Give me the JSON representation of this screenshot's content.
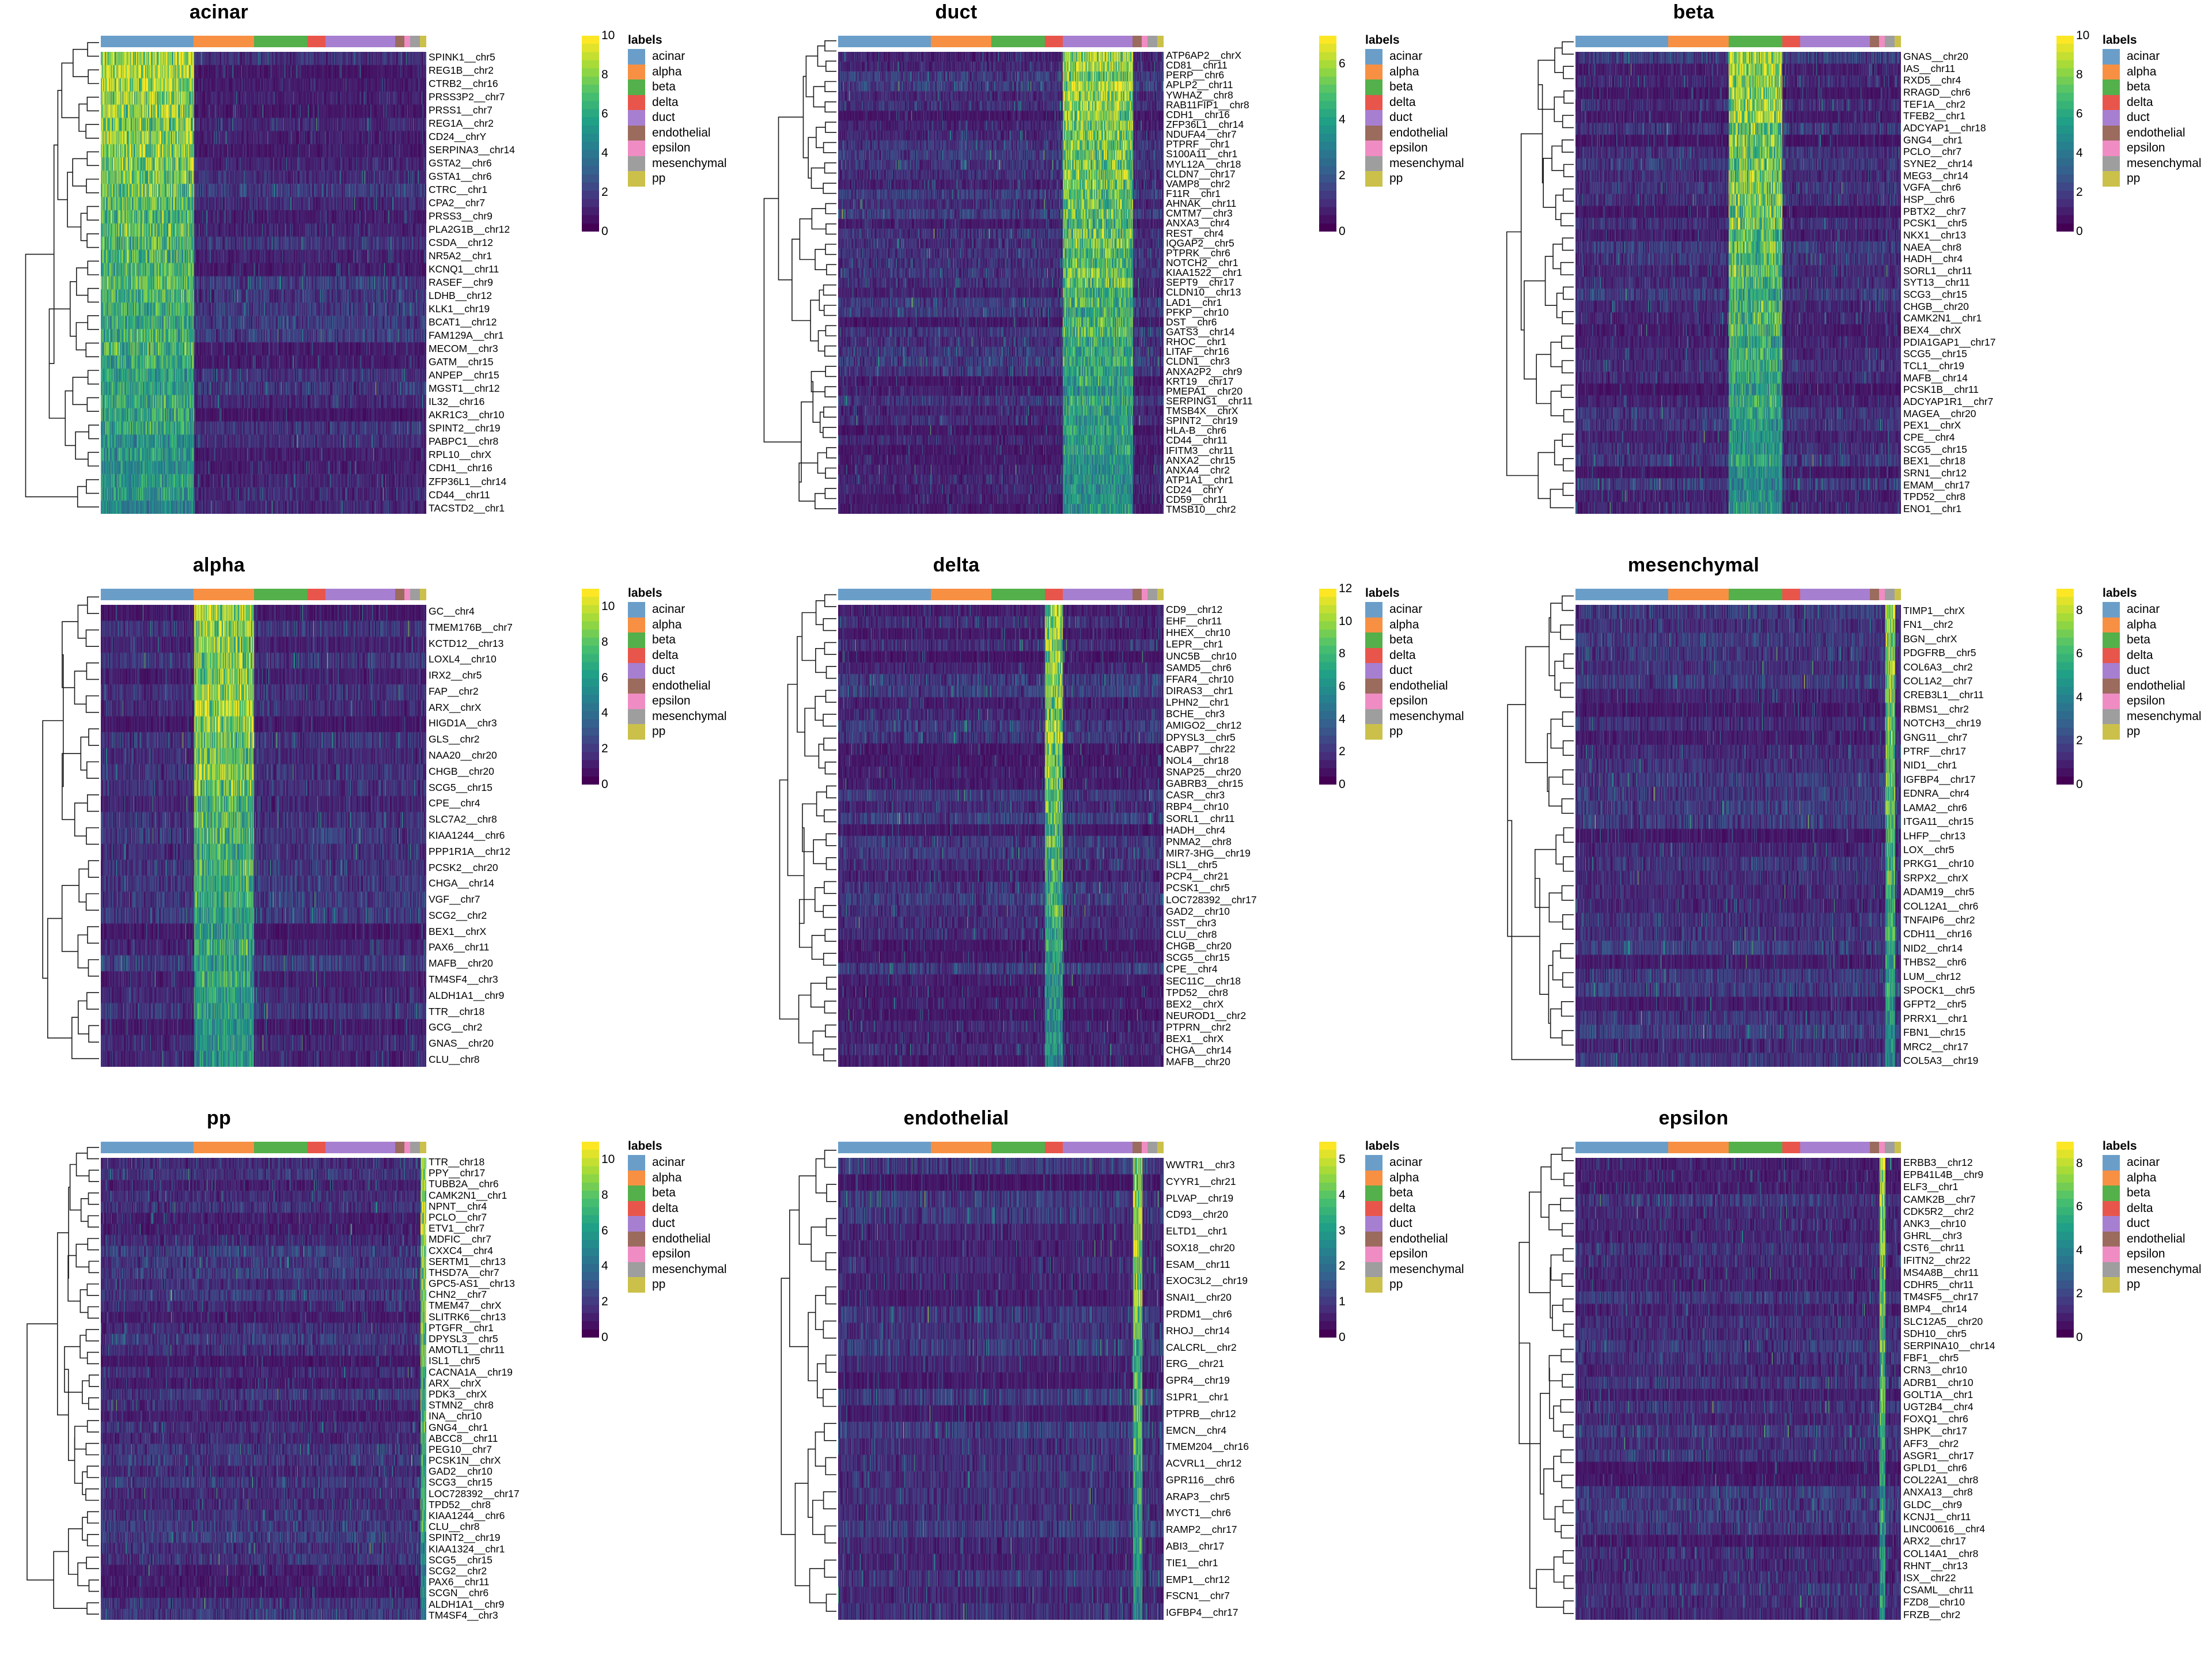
{
  "figure": {
    "type": "heatmap-grid",
    "rows": 3,
    "cols": 3,
    "colormap": "viridis",
    "legend_title": "labels",
    "class_labels": [
      "acinar",
      "alpha",
      "beta",
      "delta",
      "duct",
      "endothelial",
      "epsilon",
      "mesenchymal",
      "pp"
    ],
    "class_colors": [
      "#6A9EC9",
      "#F79043",
      "#54B04A",
      "#E8564B",
      "#A77FD0",
      "#9B6B5E",
      "#F08CC4",
      "#9E9E9E",
      "#CBC14A"
    ],
    "column_group_order": [
      "acinar",
      "alpha",
      "beta",
      "delta",
      "duct",
      "endothelial",
      "epsilon",
      "mesenchymal",
      "pp"
    ],
    "column_group_fractions": [
      0.285,
      0.185,
      0.165,
      0.055,
      0.215,
      0.028,
      0.018,
      0.03,
      0.019
    ],
    "viridis_stops": [
      "#440154",
      "#46327e",
      "#365c8d",
      "#277f8e",
      "#1fa187",
      "#4ac16d",
      "#a0da39",
      "#fde725"
    ]
  },
  "chart_data": [
    {
      "type": "heatmap",
      "title": "acinar",
      "panel_index": 0,
      "colorbar": {
        "min": 0,
        "max": 10,
        "ticks": [
          0,
          2,
          4,
          6,
          8,
          10
        ]
      },
      "ylabel": "",
      "xlabel": "",
      "genes": [
        "SPINK1__chr5",
        "REG1B__chr2",
        "CTRB2__chr16",
        "PRSS3P2__chr7",
        "PRSS1__chr7",
        "REG1A__chr2",
        "CD24__chrY",
        "SERPINA3__chr14",
        "GSTA2__chr6",
        "GSTA1__chr6",
        "CTRC__chr1",
        "CPA2__chr7",
        "PRSS3__chr9",
        "PLA2G1B__chr12",
        "CSDA__chr12",
        "NR5A2__chr1",
        "KCNQ1__chr11",
        "RASEF__chr9",
        "LDHB__chr12",
        "KLK1__chr19",
        "BCAT1__chr12",
        "FAM129A__chr1",
        "MECOM__chr3",
        "GATM__chr15",
        "ANPEP__chr15",
        "MGST1__chr12",
        "IL32__chr16",
        "AKR1C3__chr10",
        "SPINT2__chr19",
        "PABPC1__chr8",
        "RPL10__chrX",
        "CDH1__chr16",
        "ZFP36L1__chr14",
        "CD44__chr11",
        "TACSTD2__chr1"
      ],
      "high_block": "acinar"
    },
    {
      "type": "heatmap",
      "title": "duct",
      "panel_index": 1,
      "colorbar": {
        "min": 0,
        "max": 7,
        "ticks": [
          0,
          2,
          4,
          6
        ]
      },
      "ylabel": "",
      "xlabel": "",
      "genes": [
        "ATP6AP2__chrX",
        "CD81__chr11",
        "PERP__chr6",
        "APLP2__chr11",
        "YWHAZ__chr8",
        "RAB11FIP1__chr8",
        "CDH1__chr16",
        "ZFP36L1__chr14",
        "NDUFA4__chr7",
        "PTPRF__chr1",
        "S100A11__chr1",
        "MYL12A__chr18",
        "CLDN7__chr17",
        "VAMP8__chr2",
        "F11R__chr1",
        "AHNAK__chr11",
        "CMTM7__chr3",
        "ANXA3__chr4",
        "REST__chr4",
        "IQGAP2__chr5",
        "PTPRK__chr6",
        "NOTCH2__chr1",
        "KIAA1522__chr1",
        "SEPT9__chr17",
        "CLDN10__chr13",
        "LAD1__chr1",
        "PFKP__chr10",
        "DST__chr6",
        "GATS3__chr14",
        "RHOC__chr1",
        "LITAF__chr16",
        "CLDN1__chr3",
        "ANXA2P2__chr9",
        "KRT19__chr17",
        "PMEPA1__chr20",
        "SERPING1__chr11",
        "TMSB4X__chrX",
        "SPINT2__chr19",
        "HLA-B__chr6",
        "CD44__chr11",
        "IFITM3__chr11",
        "ANXA2__chr15",
        "ANXA4__chr2",
        "ATP1A1__chr1",
        "CD24__chrY",
        "CD59__chr11",
        "TMSB10__chr2"
      ],
      "high_block": "duct"
    },
    {
      "type": "heatmap",
      "title": "beta",
      "panel_index": 2,
      "colorbar": {
        "min": 0,
        "max": 10,
        "ticks": [
          0,
          2,
          4,
          6,
          8,
          10
        ]
      },
      "ylabel": "",
      "xlabel": "",
      "genes": [
        "GNAS__chr20",
        "IAS__chr11",
        "RXD5__chr4",
        "RRAGD__chr6",
        "TEF1A__chr2",
        "TFEB2__chr1",
        "ADCYAP1__chr18",
        "GNG4__chr1",
        "PCLO__chr7",
        "SYNE2__chr14",
        "MEG3__chr14",
        "VGFA__chr6",
        "HSP__chr6",
        "PBTX2__chr7",
        "PCSK1__chr5",
        "NKX1__chr13",
        "NAEA__chr8",
        "HADH__chr4",
        "SORL1__chr11",
        "SYT13__chr11",
        "SCG3__chr15",
        "CHGB__chr20",
        "CAMK2N1__chr1",
        "BEX4__chrX",
        "PDIA1GAP1__chr17",
        "SCG5__chr15",
        "TCL1__chr19",
        "MAFB__chr14",
        "PCSK1B__chr11",
        "ADCYAP1R1__chr7",
        "MAGEA__chr20",
        "PEX1__chrX",
        "CPE__chr4",
        "SCG5__chr15",
        "BEX1__chr18",
        "SRN1__chr12",
        "EMAM__chr17",
        "TPD52__chr8",
        "ENO1__chr1"
      ],
      "high_block": "beta"
    },
    {
      "type": "heatmap",
      "title": "alpha",
      "panel_index": 3,
      "colorbar": {
        "min": 0,
        "max": 11,
        "ticks": [
          0,
          2,
          4,
          6,
          8,
          10
        ]
      },
      "ylabel": "",
      "xlabel": "",
      "genes": [
        "GC__chr4",
        "TMEM176B__chr7",
        "KCTD12__chr13",
        "LOXL4__chr10",
        "IRX2__chr5",
        "FAP__chr2",
        "ARX__chrX",
        "HIGD1A__chr3",
        "GLS__chr2",
        "NAA20__chr20",
        "CHGB__chr20",
        "SCG5__chr15",
        "CPE__chr4",
        "SLC7A2__chr8",
        "KIAA1244__chr6",
        "PPP1R1A__chr12",
        "PCSK2__chr20",
        "CHGA__chr14",
        "VGF__chr7",
        "SCG2__chr2",
        "BEX1__chrX",
        "PAX6__chr11",
        "MAFB__chr20",
        "TM4SF4__chr3",
        "ALDH1A1__chr9",
        "TTR__chr18",
        "GCG__chr2",
        "GNAS__chr20",
        "CLU__chr8"
      ],
      "high_block": "alpha"
    },
    {
      "type": "heatmap",
      "title": "delta",
      "panel_index": 4,
      "colorbar": {
        "min": 0,
        "max": 12,
        "ticks": [
          0,
          2,
          4,
          6,
          8,
          10,
          12
        ]
      },
      "ylabel": "",
      "xlabel": "",
      "genes": [
        "CD9__chr12",
        "EHF__chr11",
        "HHEX__chr10",
        "LEPR__chr1",
        "UNC5B__chr10",
        "SAMD5__chr6",
        "FFAR4__chr10",
        "DIRAS3__chr1",
        "LPHN2__chr1",
        "BCHE__chr3",
        "AMIGO2__chr12",
        "DPYSL3__chr5",
        "CABP7__chr22",
        "NOL4__chr18",
        "SNAP25__chr20",
        "GABRB3__chr15",
        "CASR__chr3",
        "RBP4__chr10",
        "SORL1__chr11",
        "HADH__chr4",
        "PNMA2__chr8",
        "MIR7-3HG__chr19",
        "ISL1__chr5",
        "PCP4__chr21",
        "PCSK1__chr5",
        "LOC728392__chr17",
        "GAD2__chr10",
        "SST__chr3",
        "CLU__chr8",
        "CHGB__chr20",
        "SCG5__chr15",
        "CPE__chr4",
        "SEC11C__chr18",
        "TPD52__chr8",
        "BEX2__chrX",
        "NEUROD1__chr2",
        "PTPRN__chr2",
        "BEX1__chrX",
        "CHGA__chr14",
        "MAFB__chr20"
      ],
      "high_block": "delta"
    },
    {
      "type": "heatmap",
      "title": "mesenchymal",
      "panel_index": 5,
      "colorbar": {
        "min": 0,
        "max": 9,
        "ticks": [
          0,
          2,
          4,
          6,
          8
        ]
      },
      "ylabel": "",
      "xlabel": "",
      "genes": [
        "TIMP1__chrX",
        "FN1__chr2",
        "BGN__chrX",
        "PDGFRB__chr5",
        "COL6A3__chr2",
        "COL1A2__chr7",
        "CREB3L1__chr11",
        "RBMS1__chr2",
        "NOTCH3__chr19",
        "GNG11__chr7",
        "PTRF__chr17",
        "NID1__chr1",
        "IGFBP4__chr17",
        "EDNRA__chr4",
        "LAMA2__chr6",
        "ITGA11__chr15",
        "LHFP__chr13",
        "LOX__chr5",
        "PRKG1__chr10",
        "SRPX2__chrX",
        "ADAM19__chr5",
        "COL12A1__chr6",
        "TNFAIP6__chr2",
        "CDH11__chr16",
        "NID2__chr14",
        "THBS2__chr6",
        "LUM__chr12",
        "SPOCK1__chr5",
        "GFPT2__chr5",
        "PRRX1__chr1",
        "FBN1__chr15",
        "MRC2__chr17",
        "COL5A3__chr19"
      ],
      "high_block": "mesenchymal"
    },
    {
      "type": "heatmap",
      "title": "pp",
      "panel_index": 6,
      "colorbar": {
        "min": 0,
        "max": 11,
        "ticks": [
          0,
          2,
          4,
          6,
          8,
          10
        ]
      },
      "ylabel": "",
      "xlabel": "",
      "genes": [
        "TTR__chr18",
        "PPY__chr17",
        "TUBB2A__chr6",
        "CAMK2N1__chr1",
        "NPNT__chr4",
        "PCLO__chr7",
        "ETV1__chr7",
        "MDFIC__chr7",
        "CXXC4__chr4",
        "SERTM1__chr13",
        "THSD7A__chr7",
        "GPC5-AS1__chr13",
        "CHN2__chr7",
        "TMEM47__chrX",
        "SLITRK6__chr13",
        "PTGFR__chr1",
        "DPYSL3__chr5",
        "AMOTL1__chr11",
        "ISL1__chr5",
        "CACNA1A__chr19",
        "ARX__chrX",
        "PDK3__chrX",
        "STMN2__chr8",
        "INA__chr10",
        "GNG4__chr1",
        "ABCC8__chr11",
        "PEG10__chr7",
        "PCSK1N__chrX",
        "GAD2__chr10",
        "SCG3__chr15",
        "LOC728392__chr17",
        "TPD52__chr8",
        "KIAA1244__chr6",
        "CLU__chr8",
        "SPINT2__chr19",
        "KIAA1324__chr1",
        "SCG5__chr15",
        "SCG2__chr2",
        "PAX6__chr11",
        "SCGN__chr6",
        "ALDH1A1__chr9",
        "TM4SF4__chr3"
      ],
      "high_block": "pp"
    },
    {
      "type": "heatmap",
      "title": "endothelial",
      "panel_index": 7,
      "colorbar": {
        "min": 0,
        "max": 5.5,
        "ticks": [
          0,
          1,
          2,
          3,
          4,
          5
        ]
      },
      "ylabel": "",
      "xlabel": "",
      "genes": [
        "WWTR1__chr3",
        "CYYR1__chr21",
        "PLVAP__chr19",
        "CD93__chr20",
        "ELTD1__chr1",
        "SOX18__chr20",
        "ESAM__chr11",
        "EXOC3L2__chr19",
        "SNAI1__chr20",
        "PRDM1__chr6",
        "RHOJ__chr14",
        "CALCRL__chr2",
        "ERG__chr21",
        "GPR4__chr19",
        "S1PR1__chr1",
        "PTPRB__chr12",
        "EMCN__chr4",
        "TMEM204__chr16",
        "ACVRL1__chr12",
        "GPR116__chr6",
        "ARAP3__chr5",
        "MYCT1__chr6",
        "RAMP2__chr17",
        "ABI3__chr17",
        "TIE1__chr1",
        "EMP1__chr12",
        "FSCN1__chr7",
        "IGFBP4__chr17"
      ],
      "high_block": "endothelial"
    },
    {
      "type": "heatmap",
      "title": "epsilon",
      "panel_index": 8,
      "colorbar": {
        "min": 0,
        "max": 9,
        "ticks": [
          0,
          2,
          4,
          6,
          8
        ]
      },
      "ylabel": "",
      "xlabel": "",
      "genes": [
        "ERBB3__chr12",
        "EPB41L4B__chr9",
        "ELF3__chr1",
        "CAMK2B__chr7",
        "CDK5R2__chr2",
        "ANK3__chr10",
        "GHRL__chr3",
        "CST6__chr11",
        "IFITN2__chr22",
        "MS4A8B__chr11",
        "CDHR5__chr11",
        "TM4SF5__chr17",
        "BMP4__chr14",
        "SLC12A5__chr20",
        "SDH10__chr5",
        "SERPINA10__chr14",
        "FBF1__chr5",
        "CRN3__chr10",
        "ADRB1__chr10",
        "GOLT1A__chr1",
        "UGT2B4__chr4",
        "FOXQ1__chr6",
        "SHPK__chr17",
        "AFF3__chr2",
        "ASGR1__chr17",
        "GPLD1__chr6",
        "COL22A1__chr8",
        "ANXA13__chr8",
        "GLDC__chr9",
        "KCNJ1__chr11",
        "LINC00616__chr4",
        "ARX2__chr17",
        "COL14A1__chr8",
        "RHNT__chr13",
        "ISX__chr22",
        "CSAML__chr11",
        "FZD8__chr10",
        "FRZB__chr2"
      ],
      "high_block": "epsilon"
    }
  ]
}
